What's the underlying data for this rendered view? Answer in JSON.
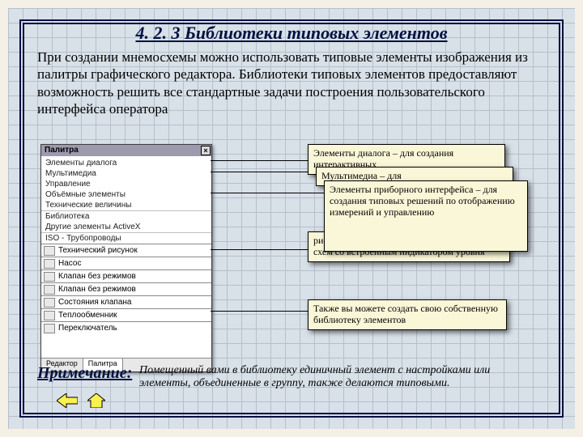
{
  "title": "4. 2. 3 Библиотеки типовых элементов",
  "body": "При создании мнемосхемы можно использовать типовые элементы изображения из палитры графического редактора. Библиотеки типовых элементов предоставляют возможность решить все стандартные задачи построения пользовательского интерфейса оператора",
  "palette": {
    "title": "Палитра",
    "items": [
      "Элементы диалога",
      "Мультимедиа",
      "Управление",
      "Объёмные элементы",
      "Технические величины",
      "Библиотека",
      "Другие элементы ActiveX",
      "ISO - Трубопроводы"
    ],
    "icon_items": [
      "Технический рисунок",
      "Насос",
      "Клапан без режимов",
      "Клапан без режимов",
      "Состояния клапана",
      "Теплообменник",
      "Переключатель"
    ],
    "tabs": [
      "Редактор",
      "Палитра"
    ]
  },
  "callouts": {
    "c1": "Элементы диалога – для создания интерактивных",
    "c2": "Мультимедиа – для",
    "c3": "Элементы приборного интерфейса – для создания типовых решений по отображению измерений и управлению",
    "c4": "рисования реалистических технологических схем со встроенным индикатором уровня",
    "c5": "Также вы можете создать свою собственную библиотеку элементов"
  },
  "footer": {
    "label": "Примечание:",
    "text": "Помещенный вами в библиотеку единичный элемент с настройками или элементы, объединенные в группу, также делаются типовыми."
  }
}
